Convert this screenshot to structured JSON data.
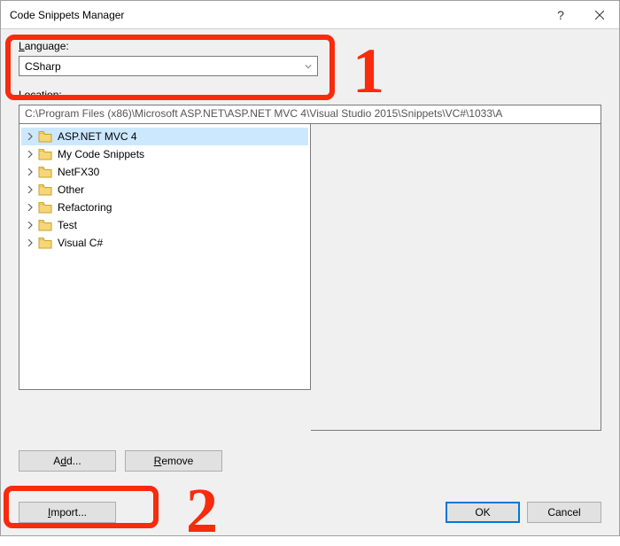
{
  "titlebar": {
    "title": "Code Snippets Manager"
  },
  "language": {
    "label_pre": "",
    "label_underlined": "L",
    "label_post": "anguage:",
    "value": "CSharp"
  },
  "location": {
    "label": "Location:",
    "value": "C:\\Program Files (x86)\\Microsoft ASP.NET\\ASP.NET MVC 4\\Visual Studio 2015\\Snippets\\VC#\\1033\\A"
  },
  "tree": {
    "items": [
      {
        "label": "ASP.NET MVC 4",
        "selected": true
      },
      {
        "label": "My Code Snippets",
        "selected": false
      },
      {
        "label": "NetFX30",
        "selected": false
      },
      {
        "label": "Other",
        "selected": false
      },
      {
        "label": "Refactoring",
        "selected": false
      },
      {
        "label": "Test",
        "selected": false
      },
      {
        "label": "Visual C#",
        "selected": false
      }
    ]
  },
  "buttons": {
    "add_pre": "A",
    "add_under": "d",
    "add_post": "d...",
    "remove_under": "R",
    "remove_post": "emove",
    "import_under": "I",
    "import_post": "mport...",
    "ok": "OK",
    "cancel": "Cancel"
  },
  "annotations": {
    "num1": "1",
    "num2": "2"
  }
}
